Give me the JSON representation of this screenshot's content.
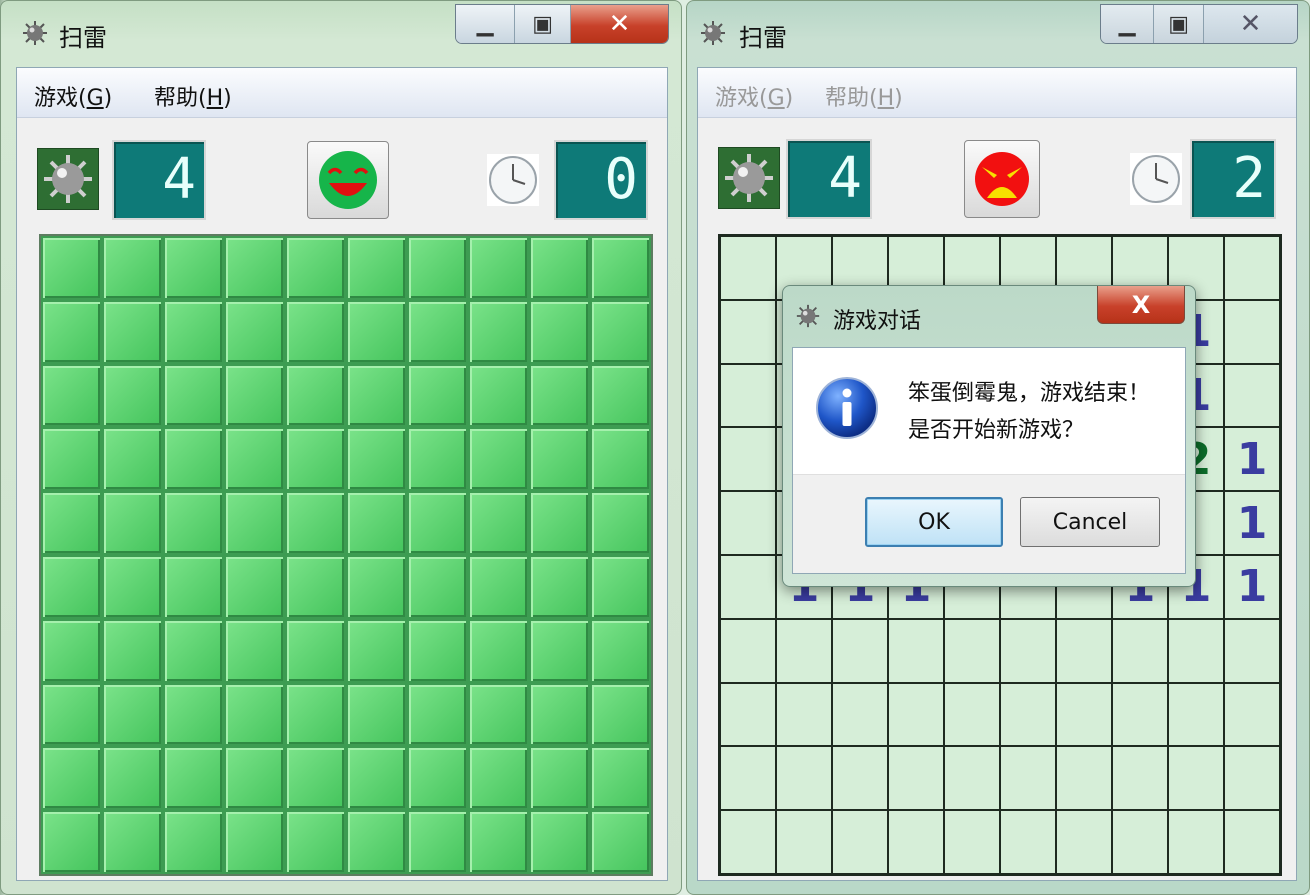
{
  "left_window": {
    "title": "扫雷",
    "menu": [
      {
        "label": "游戏(G)",
        "text": "游戏(",
        "key": "G",
        "end": ")"
      },
      {
        "label": "帮助(H)",
        "text": "帮助(",
        "key": "H",
        "end": ")"
      }
    ],
    "mine_counter": "4",
    "timer": "0",
    "face": "smile-face",
    "board": {
      "rows": 10,
      "cols": 10,
      "state": "all-covered"
    }
  },
  "right_window": {
    "title": "扫雷",
    "menu": [
      {
        "label": "游戏(G)",
        "text": "游戏(",
        "key": "G",
        "end": ")"
      },
      {
        "label": "帮助(H)",
        "text": "帮助(",
        "key": "H",
        "end": ")"
      }
    ],
    "menu_disabled": true,
    "mine_counter": "4",
    "timer": "2",
    "face": "angry-face",
    "board": {
      "rows": 10,
      "cols": 10,
      "visible_numbers": [
        {
          "row": 1,
          "col": 8,
          "value": "1"
        },
        {
          "row": 2,
          "col": 8,
          "value": "1"
        },
        {
          "row": 3,
          "col": 8,
          "value": "2"
        },
        {
          "row": 3,
          "col": 9,
          "value": "1"
        },
        {
          "row": 4,
          "col": 9,
          "value": "1"
        },
        {
          "row": 5,
          "col": 1,
          "value": "1"
        },
        {
          "row": 5,
          "col": 2,
          "value": "1"
        },
        {
          "row": 5,
          "col": 3,
          "value": "1"
        },
        {
          "row": 5,
          "col": 7,
          "value": "1"
        },
        {
          "row": 5,
          "col": 8,
          "value": "1"
        },
        {
          "row": 5,
          "col": 9,
          "value": "1"
        }
      ]
    }
  },
  "dialog": {
    "title": "游戏对话",
    "close_label": "X",
    "message_line1": "笨蛋倒霉鬼，游戏结束！",
    "message_line2": "是否开始新游戏？",
    "ok_label": "OK",
    "cancel_label": "Cancel",
    "icon": "info-icon"
  },
  "colors": {
    "covered_cell": "#5fd673",
    "lcd": "#0e7a78",
    "number_blue": "#3a3ca0",
    "number_green": "#0c6d2a",
    "close_red": "#c8412a"
  }
}
